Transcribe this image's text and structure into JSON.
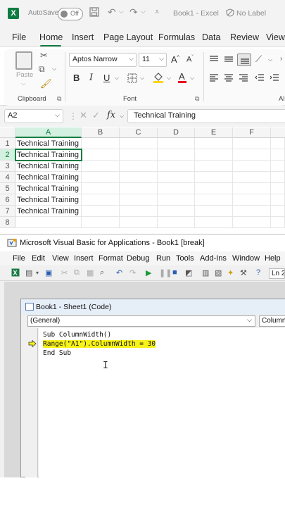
{
  "excel": {
    "app_letter": "X",
    "autosave_label": "AutoSave",
    "autosave_state": "Off",
    "title": "Book1 - Excel",
    "sensitivity": "No Label",
    "tabs": [
      "File",
      "Home",
      "Insert",
      "Page Layout",
      "Formulas",
      "Data",
      "Review",
      "View"
    ],
    "active_tab": "Home",
    "ribbon": {
      "clipboard_label": "Clipboard",
      "paste_label": "Paste",
      "font_label": "Font",
      "font_name": "Aptos Narrow",
      "font_size": "11",
      "bold": "B",
      "italic": "I",
      "underline": "U",
      "grow_font": "A",
      "shrink_font": "A",
      "alignment_partial": "Ali"
    },
    "formula_bar": {
      "name_box": "A2",
      "fx": "fx",
      "content": "Technical Training"
    },
    "columns": [
      "A",
      "B",
      "C",
      "D",
      "E",
      "F"
    ],
    "rows": [
      "1",
      "2",
      "3",
      "4",
      "5",
      "6",
      "7",
      "8"
    ],
    "cells_a": [
      "Technical Training",
      "Technical Training",
      "Technical Training",
      "Technical Training",
      "Technical Training",
      "Technical Training",
      "Technical Training",
      ""
    ],
    "selected_cell": "A2",
    "accent_color": "#107c41"
  },
  "vba": {
    "title": "Microsoft Visual Basic for Applications - Book1 [break]",
    "menu": [
      "File",
      "Edit",
      "View",
      "Insert",
      "Format",
      "Debug",
      "Run",
      "Tools",
      "Add-Ins",
      "Window",
      "Help"
    ],
    "status_partial": "Ln 2",
    "code_window": {
      "title": "Book1 - Sheet1 (Code)",
      "object_combo": "(General)",
      "proc_combo": "Column",
      "lines": [
        "Sub ColumnWidth()",
        "Range(\"A1\").ColumnWidth = 30",
        "End Sub"
      ],
      "highlighted_line": 1,
      "highlight_color": "#f7f21a"
    }
  }
}
